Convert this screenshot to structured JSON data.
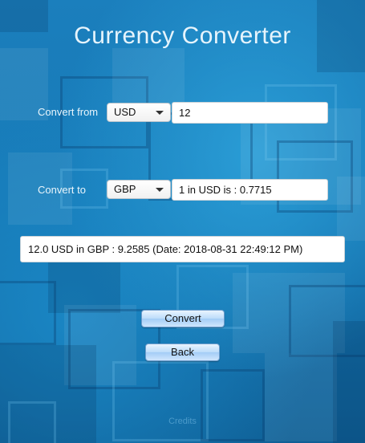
{
  "app": {
    "title": "Currency Converter"
  },
  "convert_from": {
    "label": "Convert from",
    "currency": "USD",
    "amount": "12"
  },
  "convert_to": {
    "label": "Convert to",
    "currency": "GBP",
    "rate_text": "1 in USD is : 0.7715"
  },
  "result": {
    "text": "12.0 USD in GBP : 9.2585 (Date: 2018-08-31 22:49:12 PM)"
  },
  "buttons": {
    "convert_label": "Convert",
    "back_label": "Back"
  },
  "watermark": {
    "text": "Credits"
  },
  "colors": {
    "background": "#1877b0",
    "title_text": "#e6f4fc",
    "button_gradient_top": "#e9f4ff",
    "button_gradient_bottom": "#a3cdf6"
  }
}
